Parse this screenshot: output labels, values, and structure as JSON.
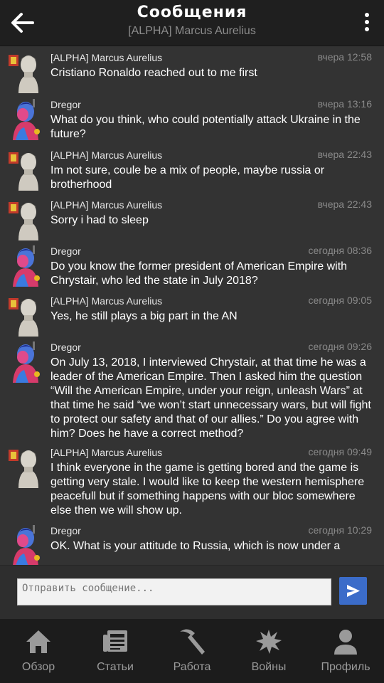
{
  "header": {
    "title": "Сообщения",
    "subtitle": "[ALPHA] Marcus Aurelius",
    "back_icon": "arrow-left-icon",
    "menu_icon": "more-vertical-icon"
  },
  "messages": [
    {
      "author": "[ALPHA] Marcus Aurelius",
      "time": "вчера 12:58",
      "text": "Cristiano Ronaldo reached out to me first",
      "avatar": "statue-avatar"
    },
    {
      "author": "Dregor",
      "time": "вчера 13:16",
      "text": "What do you think, who could potentially attack Ukraine in the future?",
      "avatar": "colorful-portrait-avatar"
    },
    {
      "author": "[ALPHA] Marcus Aurelius",
      "time": "вчера 22:43",
      "text": "Im not sure, coule be a mix of people, maybe russia or brotherhood",
      "avatar": "statue-avatar"
    },
    {
      "author": "[ALPHA] Marcus Aurelius",
      "time": "вчера 22:43",
      "text": "Sorry i had to sleep",
      "avatar": "statue-avatar"
    },
    {
      "author": "Dregor",
      "time": "сегодня 08:36",
      "text": "Do you know the former president of American Empire with Chrystair, who led the state in July 2018?",
      "avatar": "colorful-portrait-avatar"
    },
    {
      "author": "[ALPHA] Marcus Aurelius",
      "time": "сегодня 09:05",
      "text": "Yes, he still plays a big part in the AN",
      "avatar": "statue-avatar"
    },
    {
      "author": "Dregor",
      "time": "сегодня 09:26",
      "text": "On July 13, 2018, I interviewed Chrystair, at that time he was a leader of the American Empire. Then I asked him the question “Will the American Empire, under your reign, unleash Wars” at that time he said “we won’t start unnecessary wars, but will fight to protect our safety and that of our allies.” Do you agree with him? Does he have a correct method?",
      "avatar": "colorful-portrait-avatar"
    },
    {
      "author": "[ALPHA] Marcus Aurelius",
      "time": "сегодня 09:49",
      "text": "I think everyone in the game is getting bored and the game is getting very stale. I would like to keep the western hemisphere peacefull but if something happens with our bloc somewhere else then we will show up.",
      "avatar": "statue-avatar"
    },
    {
      "author": "Dregor",
      "time": "сегодня 10:29",
      "text": "OK. What is your attitude to Russia, which is now under a",
      "avatar": "colorful-portrait-avatar"
    }
  ],
  "composer": {
    "placeholder": "Отправить сообщение...",
    "send_icon": "send-icon"
  },
  "nav": [
    {
      "label": "Обзор",
      "icon": "home-icon"
    },
    {
      "label": "Статьи",
      "icon": "newspaper-icon"
    },
    {
      "label": "Работа",
      "icon": "pickaxe-icon"
    },
    {
      "label": "Войны",
      "icon": "explosion-icon"
    },
    {
      "label": "Профиль",
      "icon": "person-icon"
    }
  ],
  "colors": {
    "background": "#333333",
    "header": "#1f1f1f",
    "accent": "#3b6cc9",
    "muted_text": "#8a8a8a"
  }
}
